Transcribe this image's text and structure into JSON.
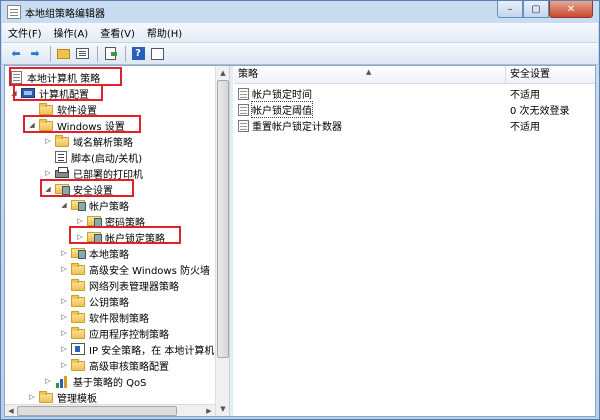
{
  "window": {
    "title": "本地组策略编辑器"
  },
  "menu": [
    {
      "label": "文件(F)"
    },
    {
      "label": "操作(A)"
    },
    {
      "label": "查看(V)"
    },
    {
      "label": "帮助(H)"
    }
  ],
  "toolbar": [
    "back-icon",
    "forward-icon",
    "up-folder-icon",
    "show-hide-tree-icon",
    "export-list-icon",
    "help-icon",
    "properties-icon"
  ],
  "tree": [
    {
      "label": "本地计算机 策略",
      "icon": "policy-icon",
      "highlight": true
    },
    {
      "label": "计算机配置",
      "icon": "computer-icon",
      "expanded": true,
      "highlight": true
    },
    {
      "label": "软件设置",
      "icon": "folder-icon"
    },
    {
      "label": "Windows 设置",
      "icon": "folder-icon",
      "expanded": true,
      "highlight": true
    },
    {
      "label": "域名解析策略",
      "icon": "folder-icon"
    },
    {
      "label": "脚本(启动/关机)",
      "icon": "script-icon"
    },
    {
      "label": "已部署的打印机",
      "icon": "printer-icon"
    },
    {
      "label": "安全设置",
      "icon": "security-folder-icon",
      "expanded": true,
      "highlight": true
    },
    {
      "label": "帐户策略",
      "icon": "security-folder-icon",
      "expanded": true
    },
    {
      "label": "密码策略",
      "icon": "security-folder-icon"
    },
    {
      "label": "帐户锁定策略",
      "icon": "security-folder-icon",
      "selected": true,
      "highlight": true
    },
    {
      "label": "本地策略",
      "icon": "security-folder-icon"
    },
    {
      "label": "高级安全 Windows 防火墙",
      "icon": "folder-icon"
    },
    {
      "label": "网络列表管理器策略",
      "icon": "folder-icon"
    },
    {
      "label": "公钥策略",
      "icon": "folder-icon"
    },
    {
      "label": "软件限制策略",
      "icon": "folder-icon"
    },
    {
      "label": "应用程序控制策略",
      "icon": "folder-icon"
    },
    {
      "label": "IP 安全策略，在 本地计算机",
      "icon": "ip-security-icon"
    },
    {
      "label": "高级审核策略配置",
      "icon": "folder-icon"
    },
    {
      "label": "基于策略的 QoS",
      "icon": "qos-chart-icon"
    },
    {
      "label": "管理模板",
      "icon": "folder-icon"
    }
  ],
  "list": {
    "columns": [
      "策略",
      "安全设置"
    ],
    "rows": [
      {
        "name": "帐户锁定时间",
        "value": "不适用"
      },
      {
        "name": "帐户锁定阈值",
        "value": "0 次无效登录",
        "focused": true
      },
      {
        "name": "重置帐户锁定计数器",
        "value": "不适用"
      }
    ]
  },
  "colors": {
    "highlight_border": "#e0202a",
    "title_bar": "#c9dcf2",
    "close_button": "#c9482c"
  }
}
